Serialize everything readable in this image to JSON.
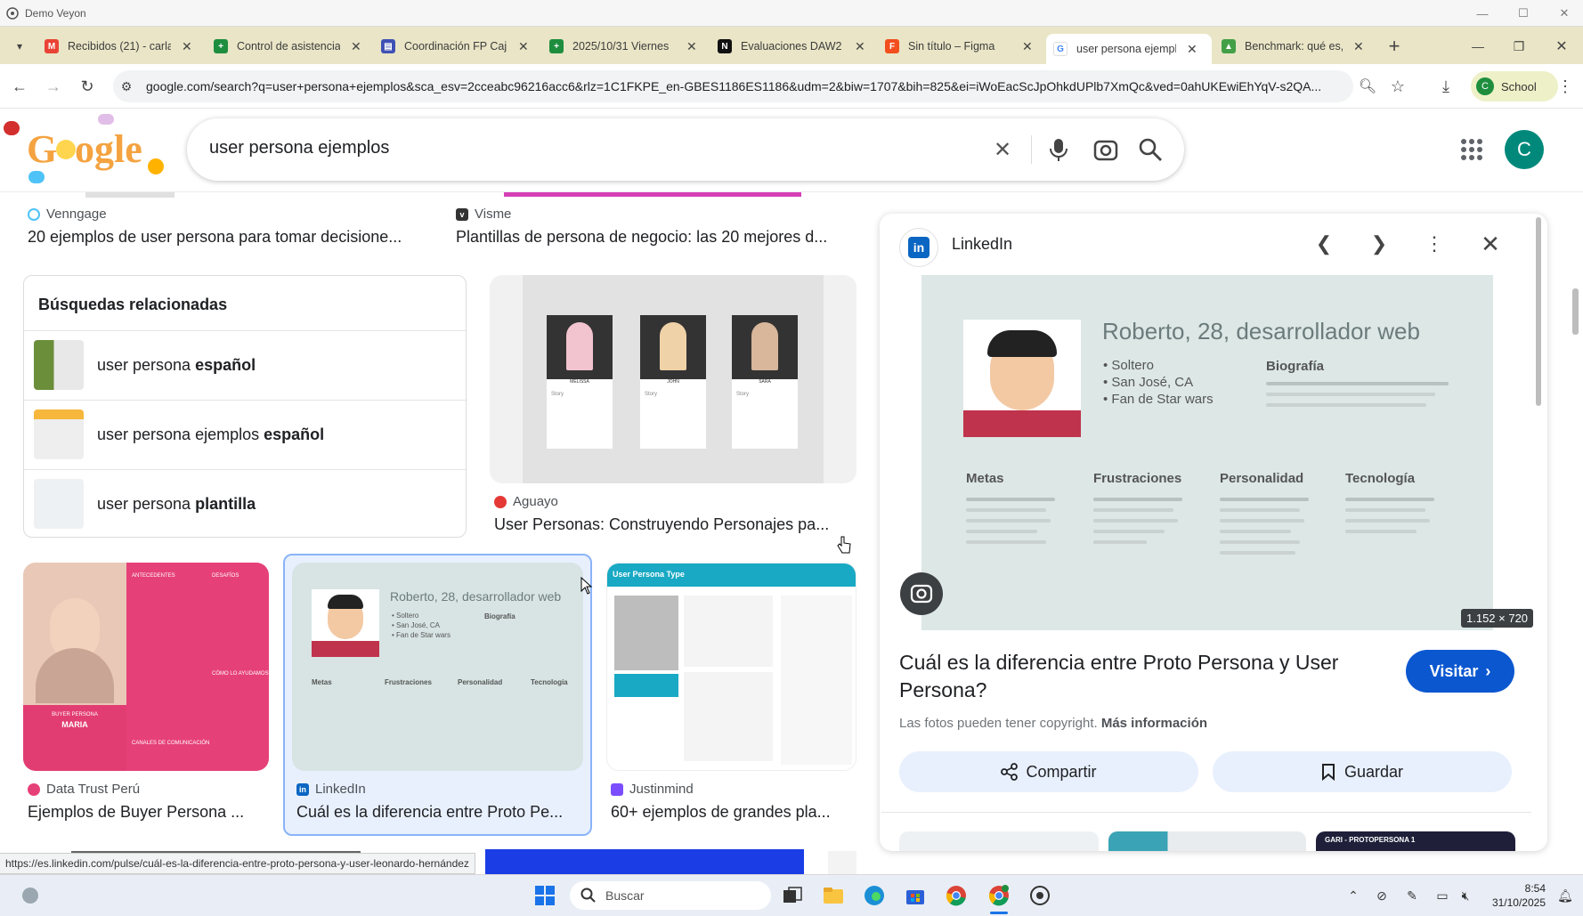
{
  "veyon": {
    "title": "Demo Veyon"
  },
  "tabs": [
    {
      "label": "Recibidos (21) - carla",
      "icon": "gmail-icon",
      "color": "#ea4335",
      "glyph": "M"
    },
    {
      "label": "Control de asistencia",
      "icon": "sheets-icon",
      "color": "#1e8e3e",
      "glyph": "+"
    },
    {
      "label": "Coordinación FP Caj",
      "icon": "forms-icon",
      "color": "#3f51b5",
      "glyph": "▤"
    },
    {
      "label": "2025/10/31 Viernes",
      "icon": "sheets-icon",
      "color": "#1e8e3e",
      "glyph": "+"
    },
    {
      "label": "Evaluaciones DAW2",
      "icon": "notion-icon",
      "color": "#111111",
      "glyph": "N"
    },
    {
      "label": "Sin título – Figma",
      "icon": "figma-icon",
      "color": "#f24e1e",
      "glyph": "F"
    },
    {
      "label": "user persona ejemplo",
      "icon": "google-icon",
      "color": "#4285f4",
      "glyph": "G"
    },
    {
      "label": "Benchmark: qué es, c",
      "icon": "site-icon",
      "color": "#43a047",
      "glyph": "▲"
    }
  ],
  "toolbar": {
    "url": "google.com/search?q=user+persona+ejemplos&sca_esv=2cceabc96216acc6&rlz=1C1FKPE_en-GBES1186ES1186&udm=2&biw=1707&bih=825&ei=iWoEacScJpOhkdUPlb7XmQc&ved=0ahUKEwiEhYqV-s2QA...",
    "profile_label": "School",
    "profile_initial": "C"
  },
  "google": {
    "query": "user persona ejemplos",
    "account_initial": "C"
  },
  "top_results": [
    {
      "source": "Venngage",
      "title": "20 ejemplos de user persona para tomar decisione..."
    },
    {
      "source": "Visme",
      "title": "Plantillas de persona de negocio: las 20 mejores d..."
    }
  ],
  "related": {
    "heading": "Búsquedas relacionadas",
    "items": [
      {
        "prefix": "user persona ",
        "bold": "español"
      },
      {
        "prefix": "user persona ejemplos ",
        "bold": "español"
      },
      {
        "prefix": "user persona ",
        "bold": "plantilla"
      }
    ]
  },
  "aguayo": {
    "source": "Aguayo",
    "title": "User Personas: Construyendo Personajes pa...",
    "names": [
      "MELISSA",
      "JOHN",
      "SARA"
    ],
    "story": "Story"
  },
  "row_results": [
    {
      "source": "Data Trust Perú",
      "title": "Ejemplos de Buyer Persona ..."
    },
    {
      "source": "LinkedIn",
      "title": "Cuál es la diferencia entre Proto Pe..."
    },
    {
      "source": "Justinmind",
      "title": "60+ ejemplos de grandes pla..."
    }
  ],
  "buyer_persona": {
    "tag": "BUYER PERSONA",
    "name": "MARIA",
    "h1": "ANTECEDENTES",
    "h2": "DESAFÍOS",
    "h3": "CÓMO LO AYUDAMOS",
    "h4": "CANALES DE COMUNICACIÓN"
  },
  "justinmind_thumb": {
    "title": "User Persona Type"
  },
  "persona_card": {
    "name": "Roberto, 28, desarrollador web",
    "facts": [
      "• Soltero",
      "• San José, CA",
      "• Fan de Star wars"
    ],
    "bio": "Biografía",
    "columns": [
      "Metas",
      "Frustraciones",
      "Personalidad",
      "Tecnología"
    ]
  },
  "panel": {
    "source": "LinkedIn",
    "dimensions": "1.152 × 720",
    "title": "Cuál es la diferencia entre Proto Persona y User Persona?",
    "visit_label": "Visitar",
    "copyright_text": "Las fotos pueden tener copyright.",
    "more_info": "Más información",
    "share_label": "Compartir",
    "save_label": "Guardar",
    "bottom_thumb_label": "GARI - PROTOPERSONA 1"
  },
  "status_url": "https://es.linkedin.com/pulse/cuál-es-la-diferencia-entre-proto-persona-y-user-leonardo-hernández",
  "taskbar": {
    "search_placeholder": "Buscar",
    "time": "8:54",
    "date": "31/10/2025"
  }
}
